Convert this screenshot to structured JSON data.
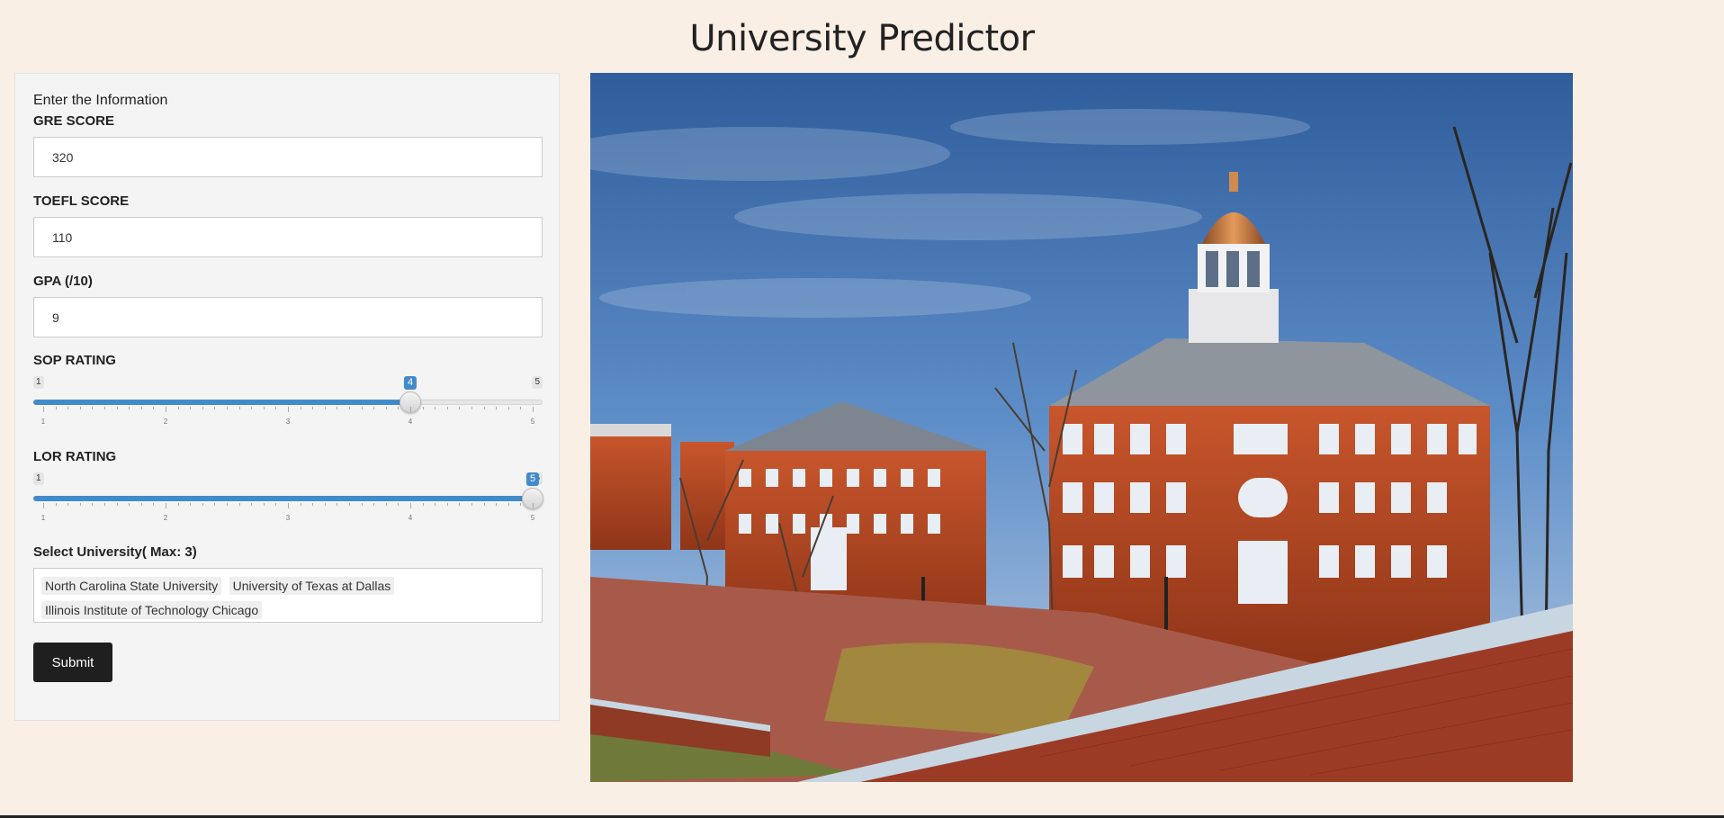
{
  "page": {
    "title": "University Predictor"
  },
  "form": {
    "intro": "Enter the Information",
    "gre": {
      "label": "GRE SCORE",
      "value": "320"
    },
    "toefl": {
      "label": "TOEFL SCORE",
      "value": "110"
    },
    "gpa": {
      "label": "GPA (/10)",
      "value": "9"
    },
    "sop": {
      "label": "SOP RATING",
      "min": 1,
      "max": 5,
      "value": 4,
      "min_label": "1",
      "max_label": "5",
      "value_label": "4",
      "ticks": [
        "1",
        "2",
        "3",
        "4",
        "5"
      ]
    },
    "lor": {
      "label": "LOR RATING",
      "min": 1,
      "max": 5,
      "value": 5,
      "min_label": "1",
      "max_label": "5",
      "value_label": "5",
      "ticks": [
        "1",
        "2",
        "3",
        "4",
        "5"
      ]
    },
    "university": {
      "label": "Select University( Max: 3)",
      "selected": [
        "North Carolina State University",
        "University of Texas at Dallas",
        "Illinois Institute of Technology Chicago"
      ]
    },
    "submit_label": "Submit"
  },
  "colors": {
    "background": "#f9efe5",
    "slider_accent": "#428bca",
    "button": "#1f1f1f"
  },
  "image": {
    "subject": "university-campus-photo"
  }
}
